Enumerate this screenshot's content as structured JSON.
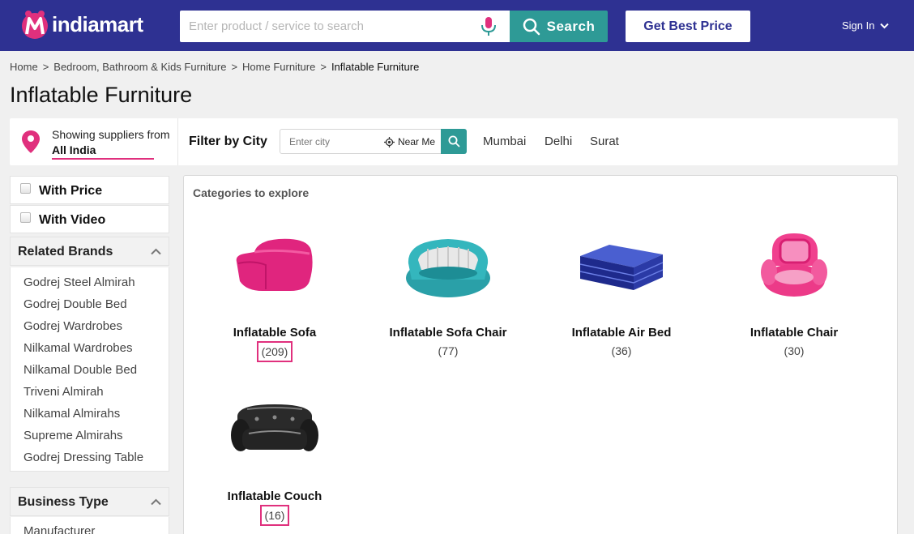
{
  "header": {
    "logo_text": "indiamart",
    "search_placeholder": "Enter product / service to search",
    "search_button": "Search",
    "best_price_button": "Get Best Price",
    "sign_in": "Sign In",
    "colors": {
      "bar": "#2e3192",
      "accent": "#2e9a96",
      "brand_pink": "#e0307d"
    }
  },
  "breadcrumb": [
    "Home",
    "Bedroom, Bathroom & Kids Furniture",
    "Home Furniture",
    "Inflatable Furniture"
  ],
  "page_title": "Inflatable Furniture",
  "location": {
    "line1": "Showing suppliers from",
    "line2": "All India"
  },
  "filter": {
    "label": "Filter by City",
    "city_placeholder": "Enter city",
    "near_me": "Near Me",
    "cities": [
      "Mumbai",
      "Delhi",
      "Surat"
    ]
  },
  "sidebar": {
    "with_price": "With Price",
    "with_video": "With Video",
    "related_brands_title": "Related Brands",
    "brands": [
      "Godrej Steel Almirah",
      "Godrej Double Bed",
      "Godrej Wardrobes",
      "Nilkamal Wardrobes",
      "Nilkamal Double Bed",
      "Triveni Almirah",
      "Nilkamal Almirahs",
      "Supreme Almirahs",
      "Godrej Dressing Table"
    ],
    "business_type_title": "Business Type",
    "business_types": [
      "Manufacturer"
    ]
  },
  "categories": {
    "heading": "Categories to explore",
    "items": [
      {
        "name": "Inflatable Sofa",
        "count": "(209)",
        "icon": "pink-inflatable-sofa-image"
      },
      {
        "name": "Inflatable Sofa Chair",
        "count": "(77)",
        "icon": "teal-inflatable-sofa-chair-image"
      },
      {
        "name": "Inflatable Air Bed",
        "count": "(36)",
        "icon": "blue-air-bed-image"
      },
      {
        "name": "Inflatable Chair",
        "count": "(30)",
        "icon": "pink-inflatable-chair-image"
      },
      {
        "name": "Inflatable Couch",
        "count": "(16)",
        "icon": "black-inflatable-couch-image"
      }
    ]
  }
}
